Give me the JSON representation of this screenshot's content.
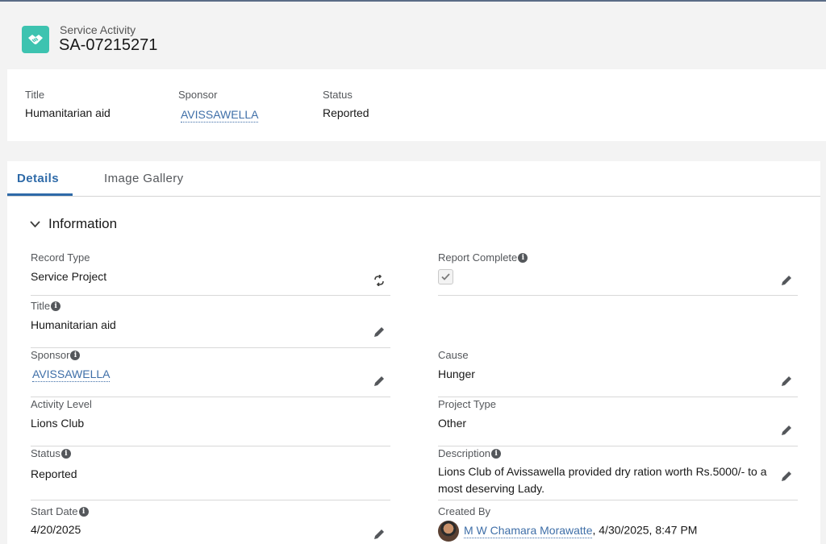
{
  "header": {
    "object_label": "Service Activity",
    "record_name": "SA-07215271",
    "icon": "handshake-icon",
    "icon_color": "#3dc3b0"
  },
  "highlights": [
    {
      "label": "Title",
      "value": "Humanitarian aid"
    },
    {
      "label": "Sponsor",
      "value": "AVISSAWELLA"
    },
    {
      "label": "Status",
      "value": "Reported"
    }
  ],
  "tabs": [
    {
      "label": "Details",
      "active": true
    },
    {
      "label": "Image Gallery",
      "active": false
    }
  ],
  "section": {
    "title": "Information"
  },
  "fields": {
    "record_type": {
      "label": "Record Type",
      "value": "Service Project"
    },
    "report_complete": {
      "label": "Report Complete",
      "checked": true
    },
    "title": {
      "label": "Title",
      "value": "Humanitarian aid"
    },
    "sponsor": {
      "label": "Sponsor",
      "value": "AVISSAWELLA"
    },
    "cause": {
      "label": "Cause",
      "value": "Hunger"
    },
    "activity_level": {
      "label": "Activity Level",
      "value": "Lions Club"
    },
    "project_type": {
      "label": "Project Type",
      "value": "Other"
    },
    "status": {
      "label": "Status",
      "value": "Reported"
    },
    "description": {
      "label": "Description",
      "value": "Lions Club of Avissawella provided dry ration worth Rs.5000/- to a most deserving Lady."
    },
    "start_date": {
      "label": "Start Date",
      "value": "4/20/2025"
    },
    "created_by": {
      "label": "Created By",
      "user": "M W Chamara Morawatte",
      "timestamp": ", 4/30/2025, 8:47 PM"
    }
  },
  "colors": {
    "accent": "#2e6aa8",
    "link": "#3f6fa8"
  }
}
